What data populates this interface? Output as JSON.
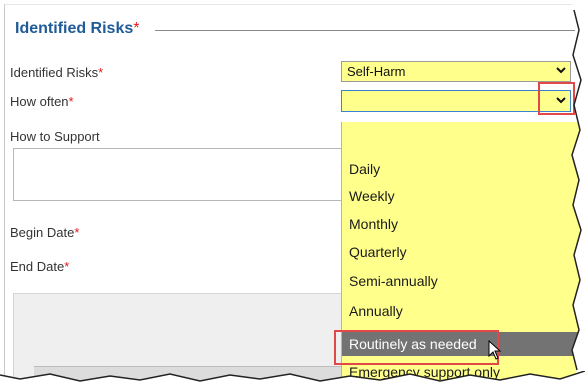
{
  "section": {
    "title": "Identified Risks",
    "required": "*"
  },
  "form": {
    "identified_risks_label": "Identified Risks",
    "identified_risks_value": "Self-Harm",
    "how_often_label": "How often",
    "how_to_support_label": "How to Support",
    "begin_date_label": "Begin Date",
    "end_date_label": "End Date",
    "required": "*"
  },
  "dropdown": {
    "options": [
      "Daily",
      "Weekly",
      "Monthly",
      "Quarterly",
      "Semi-annually",
      "Annually",
      "Routinely as needed",
      "Emergency support only"
    ],
    "highlighted": "Routinely as needed"
  },
  "icons": {
    "chevron": "chevron-down-icon",
    "cursor": "mouse-cursor-icon"
  },
  "colors": {
    "field_bg": "#ffff8c",
    "title": "#1f5b98",
    "required": "#e21b1b",
    "highlight": "#737373",
    "callout": "#e34848"
  }
}
